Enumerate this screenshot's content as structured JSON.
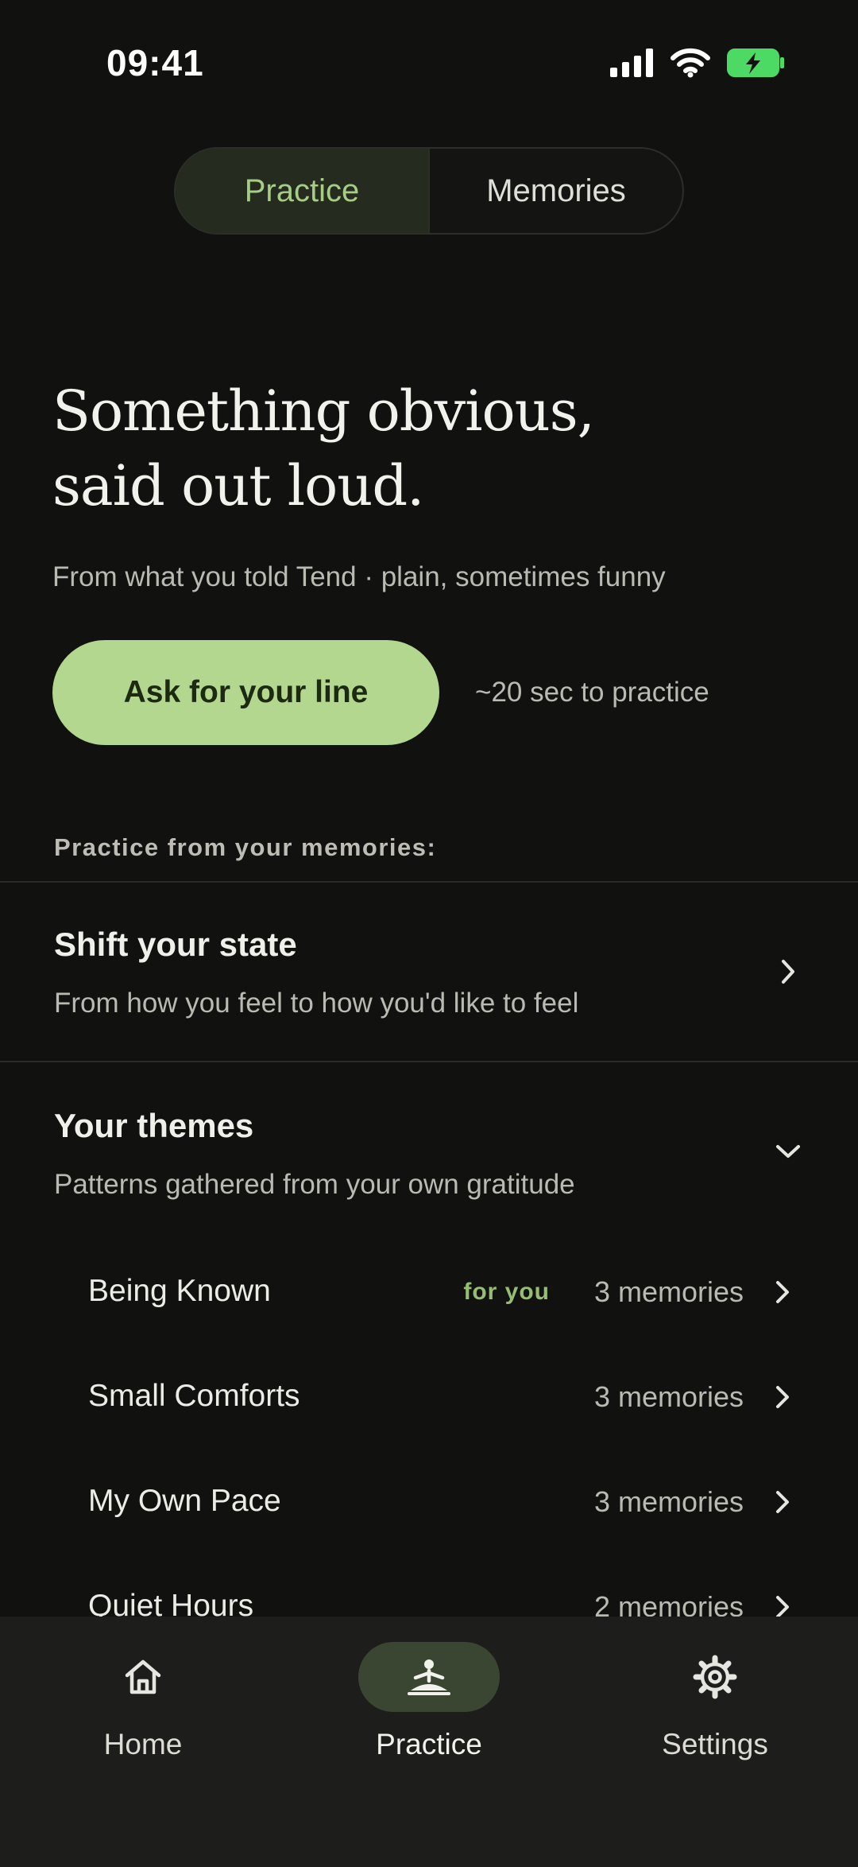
{
  "status_bar": {
    "time": "09:41"
  },
  "segmented": {
    "practice_label": "Practice",
    "memories_label": "Memories"
  },
  "hero": {
    "title_line1": "Something obvious,",
    "title_line2": "said out loud.",
    "subtitle": "From what you told Tend · plain, sometimes funny",
    "cta_label": "Ask for your line",
    "cta_note": "~20 sec to practice"
  },
  "section_label": "Practice from your memories:",
  "shift_state": {
    "title": "Shift your state",
    "subtitle": "From how you feel to how you'd like to feel"
  },
  "themes": {
    "title": "Your themes",
    "subtitle": "Patterns gathered from your own gratitude",
    "items": [
      {
        "name": "Being Known",
        "tag": "for you",
        "count": "3 memories"
      },
      {
        "name": "Small Comforts",
        "tag": "",
        "count": "3 memories"
      },
      {
        "name": "My Own Pace",
        "tag": "",
        "count": "3 memories"
      },
      {
        "name": "Quiet Hours",
        "tag": "",
        "count": "2 memories"
      }
    ]
  },
  "bottom_nav": {
    "items": [
      {
        "label": "Home",
        "icon": "home-icon"
      },
      {
        "label": "Practice",
        "icon": "meditation-icon"
      },
      {
        "label": "Settings",
        "icon": "gear-icon"
      }
    ],
    "active": "Practice"
  },
  "colors": {
    "background": "#11110f",
    "accent": "#b3d78f",
    "accent_text": "#a6cc85",
    "tag": "#95bd73",
    "nav_bg": "#1d1e1b",
    "battery": "#4cd964"
  }
}
